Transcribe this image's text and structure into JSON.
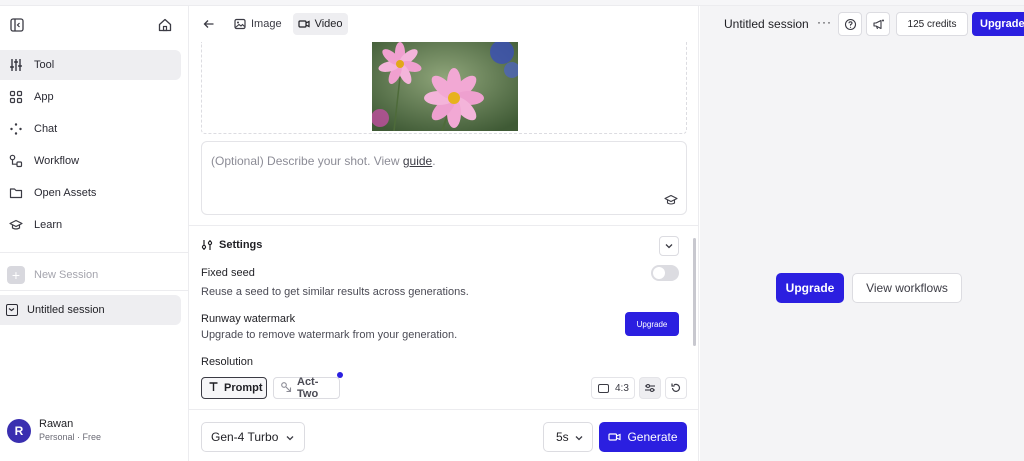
{
  "sidebar": {
    "nav": [
      {
        "label": "Tool",
        "icon": "sliders-icon",
        "active": true
      },
      {
        "label": "App",
        "icon": "grid-icon",
        "active": false
      },
      {
        "label": "Chat",
        "icon": "sparkle-icon",
        "active": false
      },
      {
        "label": "Workflow",
        "icon": "workflow-icon",
        "active": false
      },
      {
        "label": "Open Assets",
        "icon": "folder-icon",
        "active": false
      },
      {
        "label": "Learn",
        "icon": "graduation-cap-icon",
        "active": false
      }
    ],
    "new_session_label": "New Session",
    "session_label": "Untitled session",
    "user": {
      "initial": "R",
      "name": "Rawan",
      "plan": "Personal · Free"
    }
  },
  "middle": {
    "tabs": [
      {
        "label": "Image",
        "active": false
      },
      {
        "label": "Video",
        "active": true
      }
    ],
    "prompt": {
      "placeholder": "(Optional) Describe your shot. View ",
      "guide_link": "guide",
      "suffix": "."
    },
    "settings": {
      "title": "Settings",
      "fixed_seed_title": "Fixed seed",
      "fixed_seed_desc": "Reuse a seed to get similar results across generations.",
      "fixed_seed_enabled": false,
      "watermark_title": "Runway watermark",
      "watermark_desc": "Upgrade to remove watermark from your generation.",
      "watermark_button": "Upgrade",
      "resolution_title": "Resolution"
    },
    "modes": {
      "prompt_label": "Prompt",
      "act_label": "Act-Two",
      "ratio": "4:3"
    },
    "model": "Gen-4 Turbo",
    "duration": "5s",
    "generate_label": "Generate"
  },
  "right": {
    "session_title": "Untitled session",
    "more": "···",
    "credits": "125 credits",
    "upgrade_label": "Upgrade",
    "center_upgrade_label": "Upgrade",
    "view_workflows_label": "View workflows"
  },
  "colors": {
    "accent": "#2b1fe0",
    "panel_bg": "#f4f4f6",
    "active_bg": "#eeeef1"
  }
}
